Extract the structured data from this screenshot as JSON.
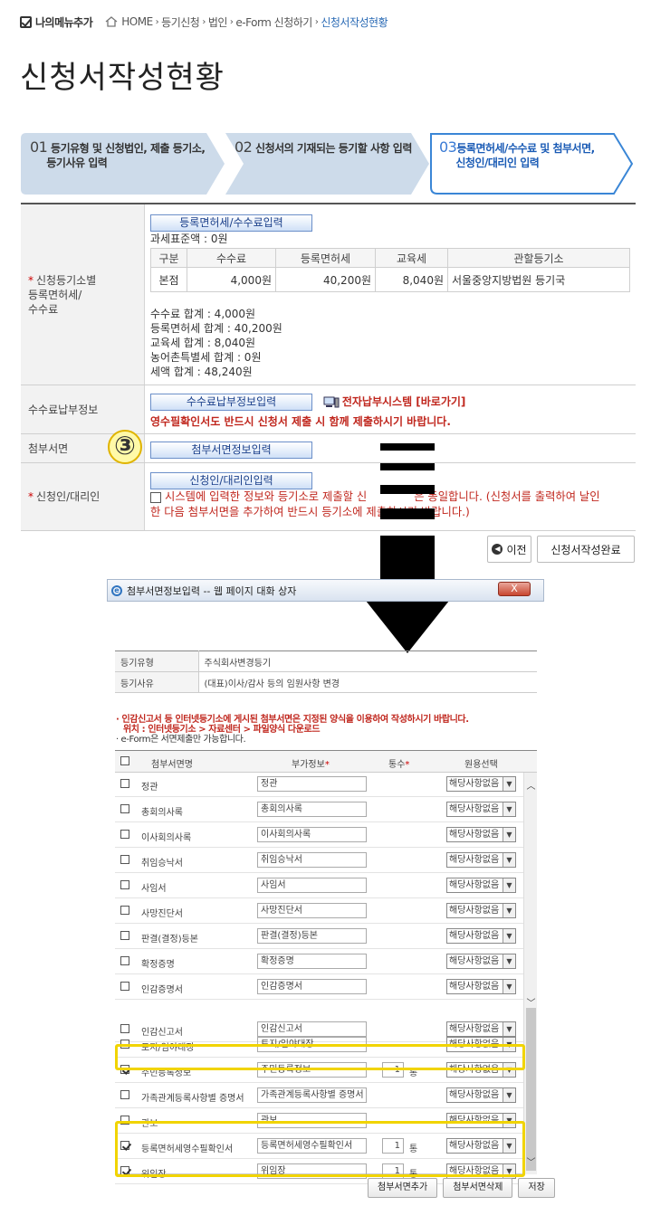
{
  "topbar": {
    "my_menu_add": "나의메뉴추가",
    "breadcrumb": [
      "HOME",
      "등기신청",
      "법인",
      "e-Form 신청하기",
      "신청서작성현황"
    ]
  },
  "page_title": "신청서작성현황",
  "steps": [
    {
      "num": "01",
      "line1": "등기유형 및 신청법인, 제출 등기소,",
      "line2": "등기사유 입력"
    },
    {
      "num": "02",
      "line1": "신청서의 기재되는 등기할 사항 입력",
      "line2": ""
    },
    {
      "num": "03",
      "line1": "등록면허세/수수료 및 첨부서면,",
      "line2": "신청인/대리인 입력"
    }
  ],
  "form": {
    "fee_section": {
      "label_line1": "신청등기소별",
      "label_line2": "등록면허세/",
      "label_line3": "수수료",
      "button": "등록면허세/수수료입력",
      "tax_base": "과세표준액 : 0원",
      "table_headers": [
        "구분",
        "수수료",
        "등록면허세",
        "교육세",
        "관할등기소"
      ],
      "table_row": [
        "본점",
        "4,000원",
        "40,200원",
        "8,040원",
        "서울중앙지방법원 등기국"
      ],
      "sums": [
        "수수료 합계 : 4,000원",
        "등록면허세 합계 : 40,200원",
        "교육세 합계 : 8,040원",
        "농어촌특별세 합계 : 0원",
        "세액 합계 : 48,240원"
      ]
    },
    "payment": {
      "label": "수수료납부정보",
      "button": "수수료납부정보입력",
      "link": "전자납부시스템 [바로가기]",
      "warning": "영수필확인서도 반드시 신청서 제출 시 함께 제출하시기 바랍니다."
    },
    "attach": {
      "label": "첨부서면",
      "badge": "③",
      "button": "첨부서면정보입력"
    },
    "applicant": {
      "label": "신청인/대리인",
      "button": "신청인/대리인입력",
      "agree_line1": "시스템에 입력한 정보와 등기소로 제출할 신",
      "agree_line1b": "은 동일합니다. (신청서를 출력하여 날인",
      "agree_line2": "한 다음 첨부서면을 추가하여 반드시 등기소에 제출하시기 바랍니다.)"
    }
  },
  "nav": {
    "prev": "이전",
    "done": "신청서작성완료"
  },
  "dialog": {
    "title": "첨부서면정보입력 -- 웹 페이지 대화 상자",
    "close": "X",
    "info": [
      {
        "key": "등기유형",
        "value": "주식회사변경등기"
      },
      {
        "key": "등기사유",
        "value": "(대표)이사/감사 등의 임원사항 변경"
      }
    ],
    "notice_line1": "· 인감신고서 등 인터넷등기소에 게시된 첨부서면은 지정된 양식을 이용하여 작성하시기 바랍니다.",
    "notice_line2": "위치 : 인터넷등기소 > 자료센터 > 파일양식 다운로드",
    "notice_line3": "· e-Form은 서면제출만 가능합니다.",
    "headers": [
      "첨부서면명",
      "부가정보",
      "통수",
      "원용선택"
    ],
    "unit": "통",
    "select_value": "해당사항없음",
    "rows": [
      {
        "name": "정관",
        "info": "정관",
        "count": "",
        "checked": false
      },
      {
        "name": "총회의사록",
        "info": "총회의사록",
        "count": "",
        "checked": false
      },
      {
        "name": "이사회의사록",
        "info": "이사회의사록",
        "count": "",
        "checked": false
      },
      {
        "name": "취임승낙서",
        "info": "취임승낙서",
        "count": "",
        "checked": false
      },
      {
        "name": "사임서",
        "info": "사임서",
        "count": "",
        "checked": false
      },
      {
        "name": "사망진단서",
        "info": "사망진단서",
        "count": "",
        "checked": false
      },
      {
        "name": "판결(결정)등본",
        "info": "판결(결정)등본",
        "count": "",
        "checked": false
      },
      {
        "name": "확정증명",
        "info": "확정증명",
        "count": "",
        "checked": false
      },
      {
        "name": "인감증명서",
        "info": "인감증명서",
        "count": "",
        "checked": false
      },
      {
        "name": "인감신고서",
        "info": "인감신고서",
        "count": "",
        "checked": false
      },
      {
        "name": "토지/임야대장",
        "info": "토지/임야대장",
        "count": "",
        "checked": false
      },
      {
        "name": "주민등록정보",
        "info": "주민등록정보",
        "count": "1",
        "checked": true
      },
      {
        "name": "가족관계등록사항별 증명서",
        "info": "가족관계등록사항별 증명서",
        "count": "",
        "checked": false
      },
      {
        "name": "관보",
        "info": "관보",
        "count": "",
        "checked": false
      },
      {
        "name": "등록면허세영수필확인서",
        "info": "등록면허세영수필확인서",
        "count": "1",
        "checked": true
      },
      {
        "name": "위임장",
        "info": "위임장",
        "count": "1",
        "checked": true
      }
    ],
    "buttons": [
      "첨부서면추가",
      "첨부서면삭제",
      "저장"
    ]
  }
}
